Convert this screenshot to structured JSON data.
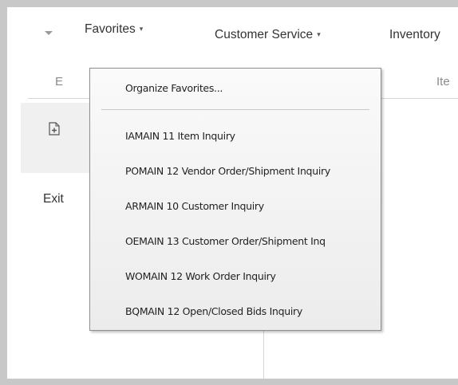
{
  "menubar": {
    "items": [
      {
        "label": "Favorites",
        "caret": "▾"
      },
      {
        "label": "Customer Service",
        "caret": "▾"
      },
      {
        "label": "Inventory"
      }
    ],
    "subnav": [
      "E",
      "Ite"
    ]
  },
  "sidebar": {
    "new_icon": "new-document-icon",
    "exit_label": "Exit"
  },
  "favorites_menu": {
    "organize": "Organize Favorites...",
    "items": [
      "IAMAIN 11 Item Inquiry",
      "POMAIN 12 Vendor Order/Shipment Inquiry",
      "ARMAIN 10 Customer Inquiry",
      "OEMAIN 13 Customer Order/Shipment Inq",
      "WOMAIN 12 Work Order Inquiry",
      "BQMAIN 12 Open/Closed Bids Inquiry"
    ]
  }
}
